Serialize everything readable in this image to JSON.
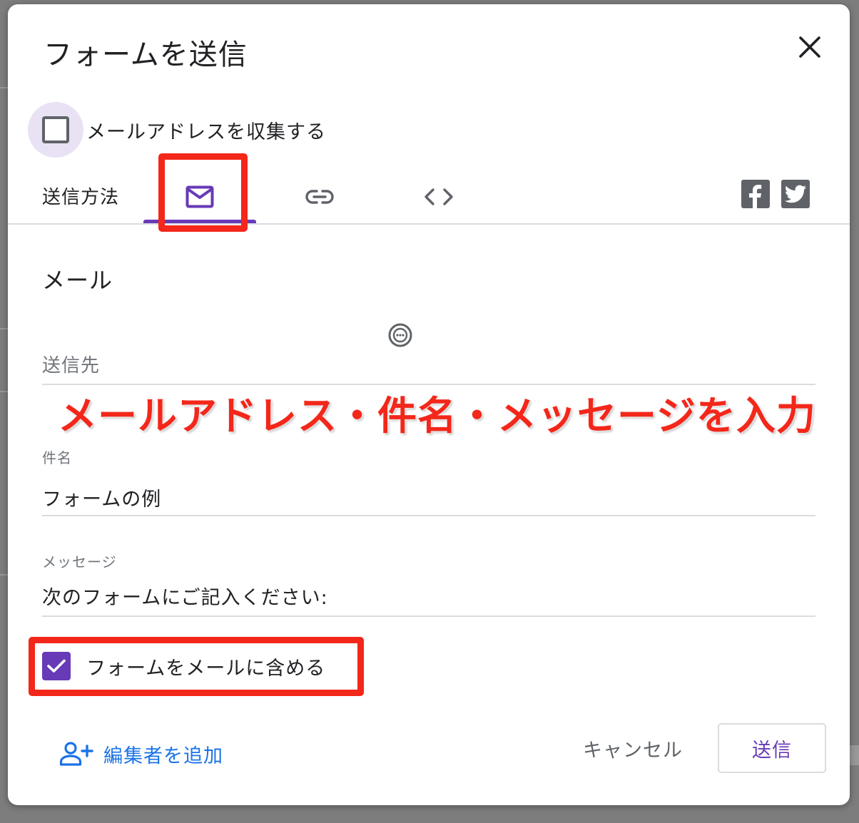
{
  "dialog": {
    "title": "フォームを送信",
    "collect_email_label": "メールアドレスを収集する",
    "collect_email_checked": false
  },
  "send_via": {
    "label": "送信方法",
    "tabs": [
      {
        "icon": "mail-icon",
        "selected": true
      },
      {
        "icon": "link-icon",
        "selected": false
      },
      {
        "icon": "code-embed-icon",
        "selected": false
      }
    ],
    "social": [
      {
        "icon": "facebook-icon"
      },
      {
        "icon": "twitter-icon"
      }
    ]
  },
  "email_section": {
    "title": "メール",
    "to_label": "送信先",
    "to_value": "",
    "subject_label": "件名",
    "subject_value": "フォームの例",
    "message_label": "メッセージ",
    "message_value": "次のフォームにご記入ください:",
    "include_form_label": "フォームをメールに含める",
    "include_form_checked": true
  },
  "annotation": {
    "text": "メールアドレス・件名・メッセージを入力"
  },
  "footer": {
    "add_editor_label": "編集者を追加",
    "cancel_label": "キャンセル",
    "send_label": "送信"
  },
  "colors": {
    "accent": "#673ab7",
    "highlight": "#f3271a",
    "link": "#1a73e8"
  }
}
